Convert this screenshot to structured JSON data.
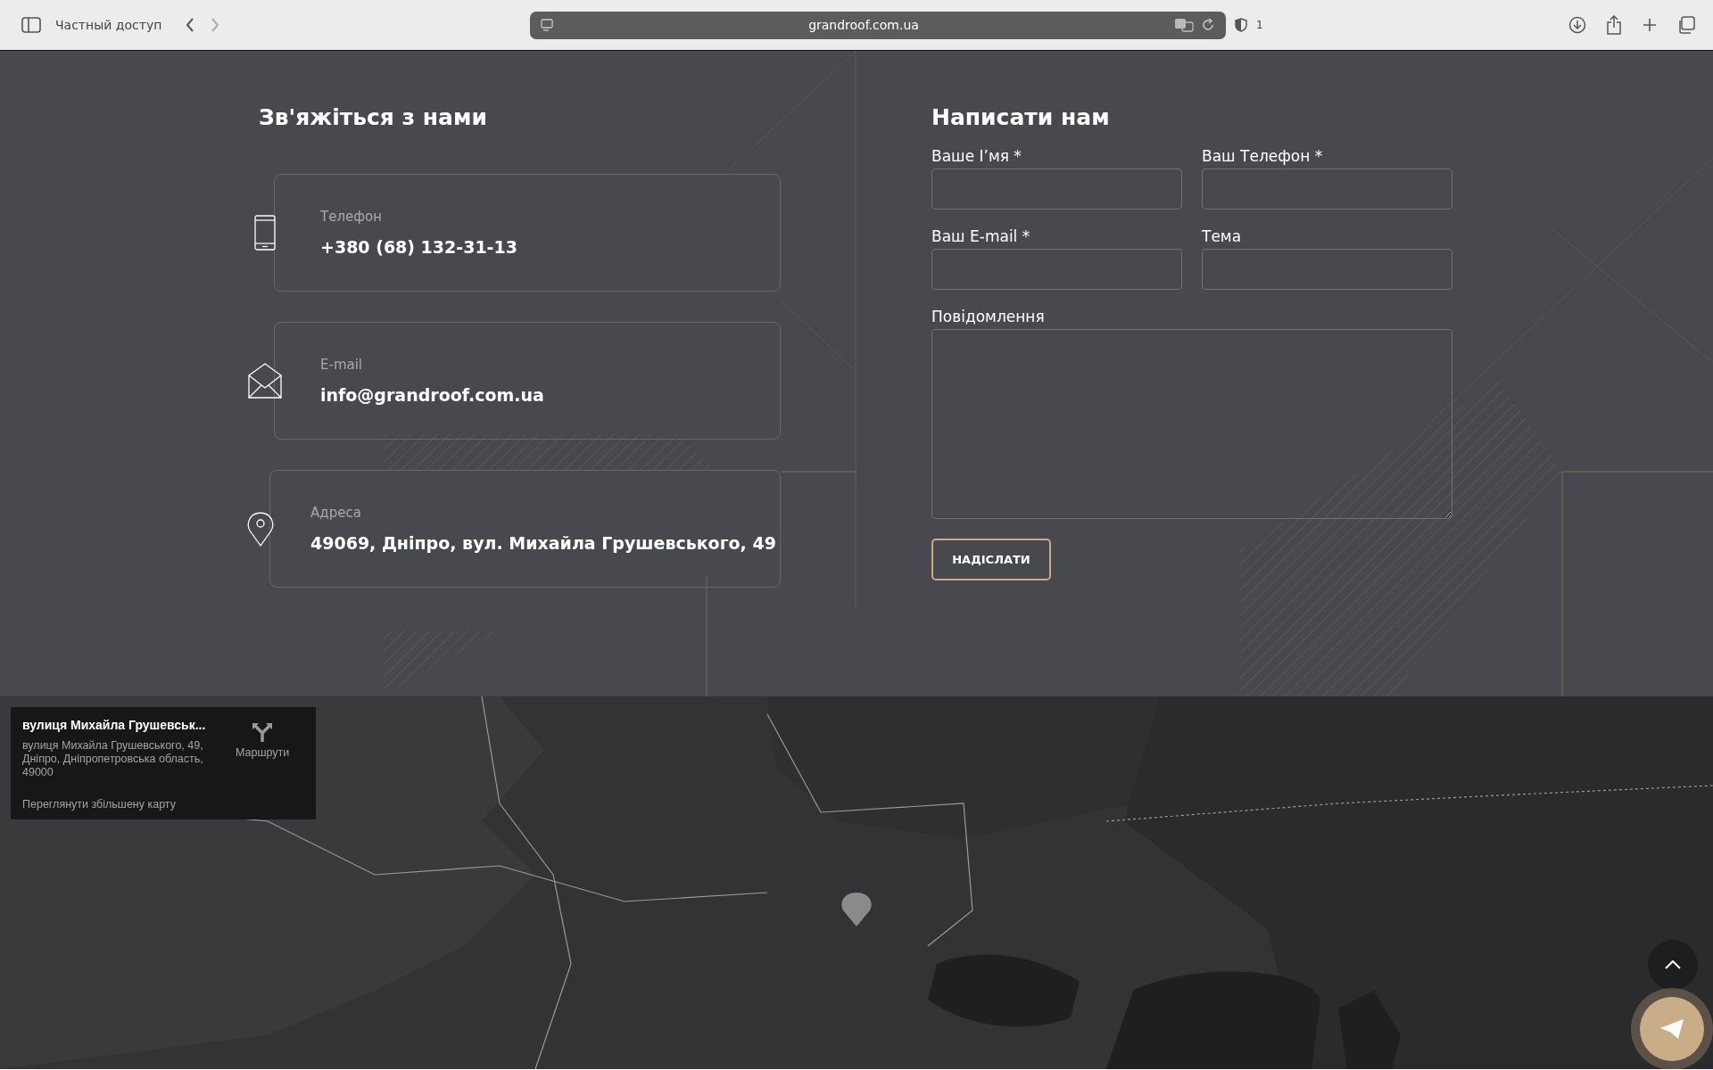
{
  "browser": {
    "sidebar_label": "Частный доступ",
    "url": "grandroof.com.ua",
    "shield_count": "1"
  },
  "contacts": {
    "title": "Зв'яжіться з нами",
    "items": [
      {
        "kind": "phone",
        "label": "Телефон",
        "value": "+380 (68) 132-31-13"
      },
      {
        "kind": "email",
        "label": "E-mail",
        "value": "info@grandroof.com.ua"
      },
      {
        "kind": "address",
        "label": "Адреса",
        "value": "49069, Дніпро, вул. Михайла Грушевського, 49"
      }
    ]
  },
  "form": {
    "title": "Написати нам",
    "fields": [
      {
        "kind": "input",
        "label": "Ваше І’мя *"
      },
      {
        "kind": "input",
        "label": "Ваш Телефон *"
      },
      {
        "kind": "input",
        "label": "Ваш E-mail *"
      },
      {
        "kind": "input",
        "label": "Тема"
      },
      {
        "kind": "textarea",
        "label": "Повідомлення"
      }
    ],
    "submit": "НАДІСЛАТИ"
  },
  "map": {
    "info": {
      "title": "вулиця Михайла Грушевськ...",
      "address": "вулиця Михайла Грушевського, 49, Дніпро, Дніпропетровська область, 49000",
      "link": "Переглянути збільшену карту",
      "directions": "Маршрути"
    }
  }
}
